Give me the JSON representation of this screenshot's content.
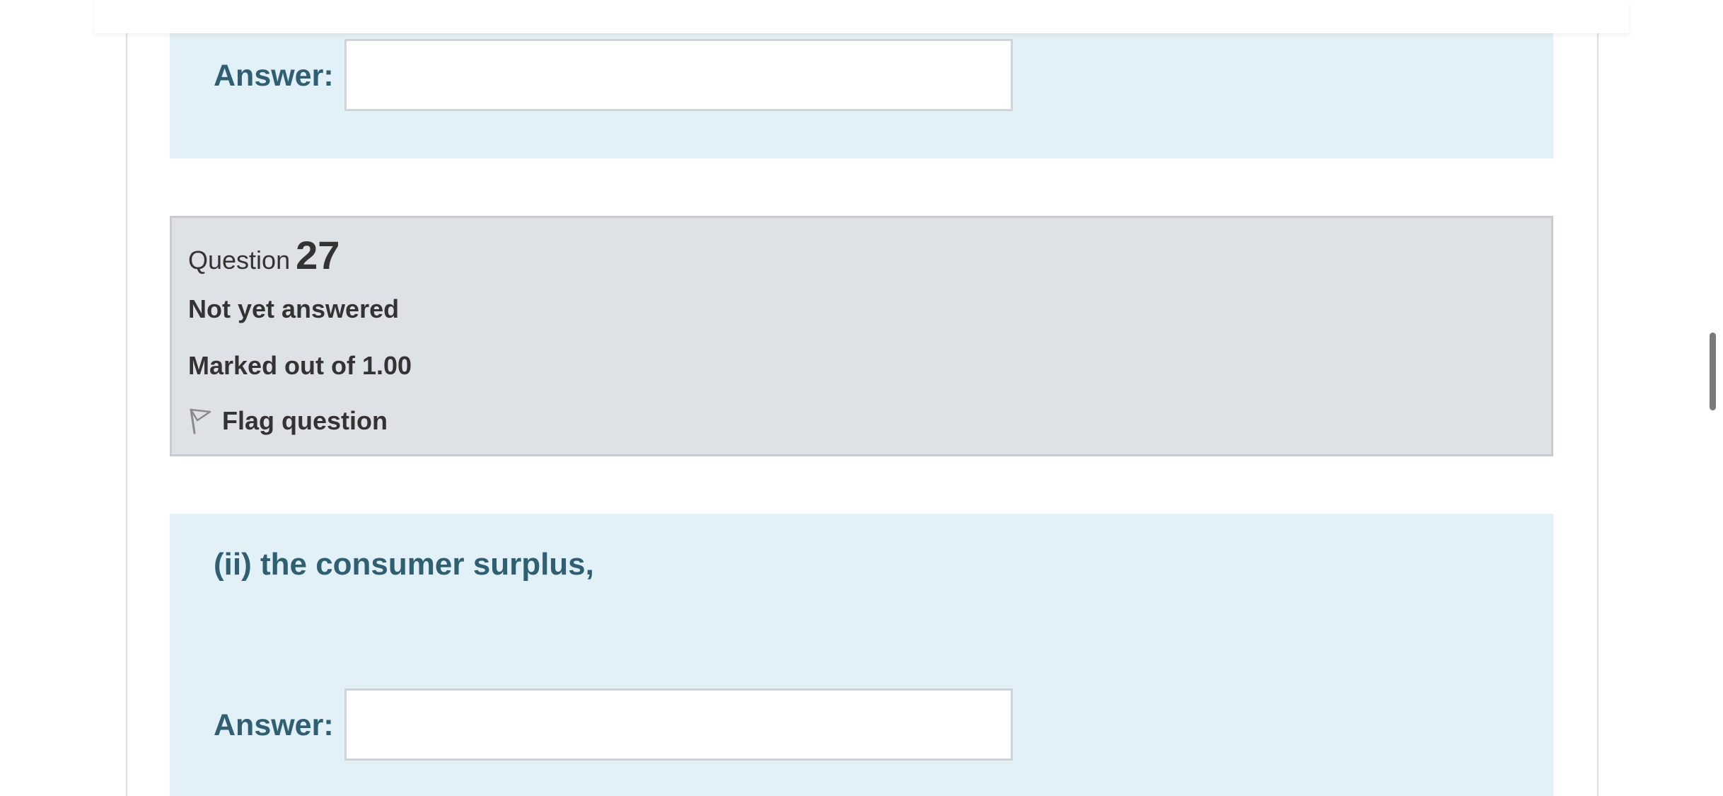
{
  "previous_question": {
    "answer_label": "Answer:",
    "answer_value": ""
  },
  "question_info": {
    "label": "Question",
    "number": "27",
    "state": "Not yet answered",
    "grade": "Marked out of 1.00",
    "flag_label": "Flag question",
    "flag_icon": "flag-outline-icon"
  },
  "current_question": {
    "text": "(ii) the consumer surplus,",
    "answer_label": "Answer:",
    "answer_value": ""
  },
  "colors": {
    "formulation_bg": "#e2f0f7",
    "info_bg": "#dee1e6",
    "question_text": "#2f5f70"
  }
}
